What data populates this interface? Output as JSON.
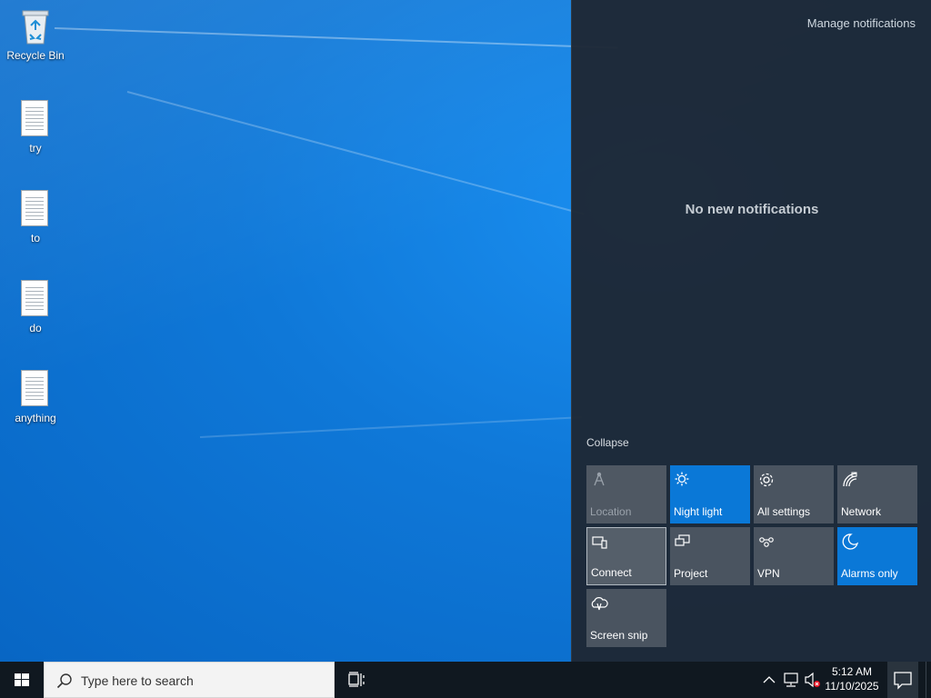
{
  "desktop": {
    "icons": [
      {
        "label": "Recycle Bin",
        "icon": "recycle-bin-icon"
      },
      {
        "label": "try",
        "icon": "text-file-icon"
      },
      {
        "label": "to",
        "icon": "text-file-icon"
      },
      {
        "label": "do",
        "icon": "text-file-icon"
      },
      {
        "label": "anything",
        "icon": "text-file-icon"
      }
    ]
  },
  "action_center": {
    "manage_label": "Manage notifications",
    "empty_message": "No new notifications",
    "collapse_label": "Collapse",
    "tiles": [
      {
        "label": "Location",
        "icon": "location-icon",
        "state": "disabled"
      },
      {
        "label": "Night light",
        "icon": "brightness-icon",
        "state": "on"
      },
      {
        "label": "All settings",
        "icon": "gear-icon",
        "state": "off"
      },
      {
        "label": "Network",
        "icon": "network-icon",
        "state": "off"
      },
      {
        "label": "Connect",
        "icon": "connect-icon",
        "state": "focused"
      },
      {
        "label": "Project",
        "icon": "project-icon",
        "state": "off"
      },
      {
        "label": "VPN",
        "icon": "vpn-icon",
        "state": "off"
      },
      {
        "label": "Alarms only",
        "icon": "moon-icon",
        "state": "on"
      },
      {
        "label": "Screen snip",
        "icon": "screen-snip-icon",
        "state": "off"
      }
    ],
    "colors": {
      "active_tile": "#0a78d7",
      "tile": "#4a5460",
      "panel": "#1e2834"
    }
  },
  "taskbar": {
    "search_placeholder": "Type here to search",
    "clock_time": "5:12 AM",
    "clock_date": "11/10/2025",
    "tray_icons": [
      "chevron-up-icon",
      "network-disconnected-icon",
      "volume-muted-icon"
    ]
  }
}
